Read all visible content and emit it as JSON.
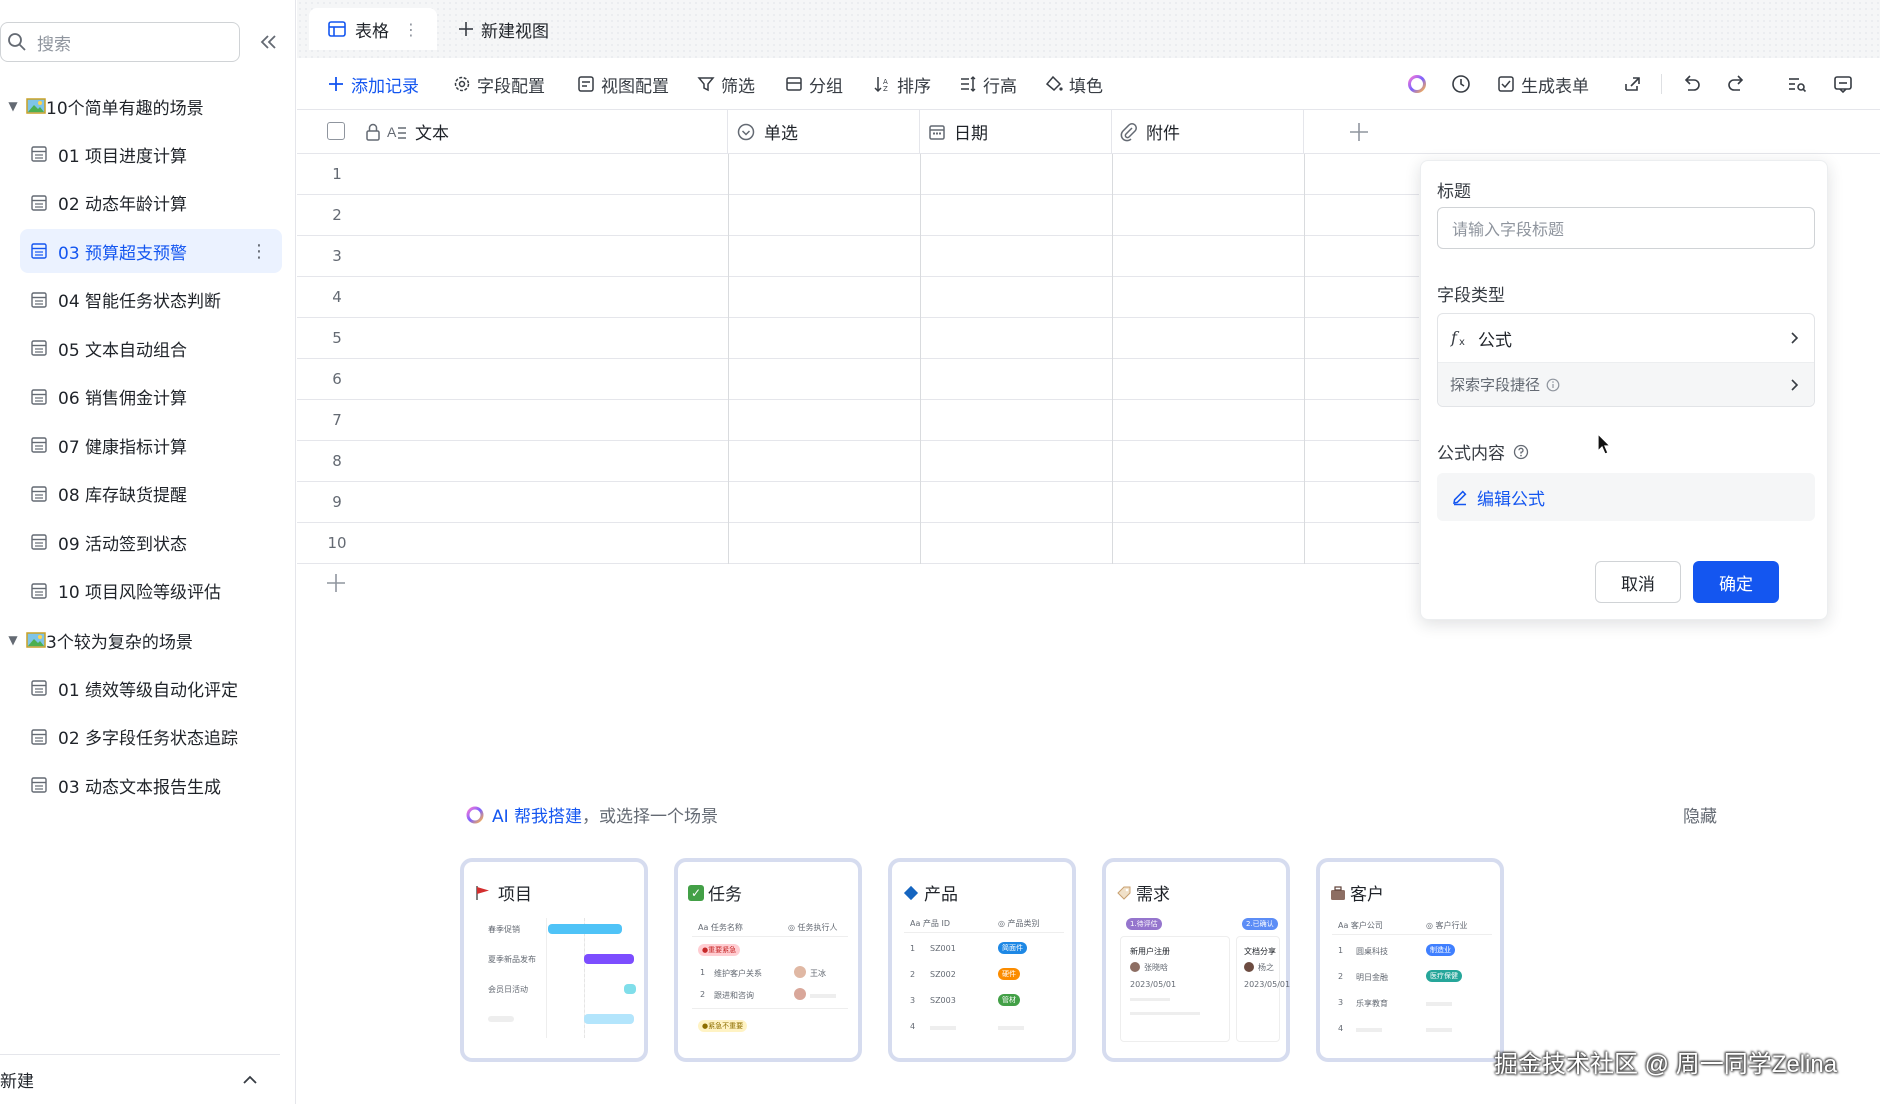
{
  "sidebar": {
    "search_placeholder": "搜索",
    "groups": [
      {
        "title": "10个简单有趣的场景",
        "items": [
          "01 项目进度计算",
          "02 动态年龄计算",
          "03 预算超支预警",
          "04 智能任务状态判断",
          "05 文本自动组合",
          "06 销售佣金计算",
          "07 健康指标计算",
          "08 库存缺货提醒",
          "09 活动签到状态",
          "10 项目风险等级评估"
        ]
      },
      {
        "title": "3个较为复杂的场景",
        "items": [
          "01 绩效等级自动化评定",
          "02 多字段任务状态追踪",
          "03 动态文本报告生成"
        ]
      }
    ],
    "active_item": "03 预算超支预警",
    "footer_label": "新建"
  },
  "views": {
    "active": "表格",
    "new_view": "新建视图"
  },
  "toolbar": {
    "add_record": "添加记录",
    "field_config": "字段配置",
    "view_config": "视图配置",
    "filter": "筛选",
    "group": "分组",
    "sort": "排序",
    "row_height": "行高",
    "fill": "填色",
    "generate_form": "生成表单"
  },
  "table": {
    "columns": [
      "文本",
      "单选",
      "日期",
      "附件"
    ],
    "rows": [
      "1",
      "2",
      "3",
      "4",
      "5",
      "6",
      "7",
      "8",
      "9",
      "10"
    ]
  },
  "panel": {
    "title_label": "标题",
    "title_placeholder": "请输入字段标题",
    "type_label": "字段类型",
    "type_value": "公式",
    "shortcut_label": "探索字段捷径",
    "formula_label": "公式内容",
    "edit_formula": "编辑公式",
    "cancel": "取消",
    "confirm": "确定"
  },
  "scenarios": {
    "ai_link": "AI 帮我搭建",
    "prompt": "，或选择一个场景",
    "hide": "隐藏",
    "cards": [
      {
        "title": "项目",
        "icon": "flag-icon"
      },
      {
        "title": "任务",
        "icon": "check-icon"
      },
      {
        "title": "产品",
        "icon": "diamond-icon"
      },
      {
        "title": "需求",
        "icon": "tag-icon"
      },
      {
        "title": "客户",
        "icon": "briefcase-icon"
      }
    ],
    "project_rows": [
      "春季促销",
      "夏季新品发布",
      "会员日活动"
    ],
    "task_headers": [
      "任务名称",
      "任务执行人"
    ],
    "task_tags": [
      "重要紧急",
      "紧急不重要"
    ],
    "task_rows": [
      "维护客户关系",
      "跟进和咨询"
    ],
    "task_assignee": "王冰",
    "product_headers": [
      "产品 ID",
      "产品类别"
    ],
    "product_ids": [
      "SZ001",
      "SZ002",
      "SZ003"
    ],
    "product_tags": [
      "简面件",
      "硬件",
      "管材"
    ],
    "demand_tags": [
      "1.待评估",
      "2.已确认"
    ],
    "demand_rows": [
      "新用户注册",
      "文档分享"
    ],
    "demand_people": [
      "张晓晗",
      "杨之"
    ],
    "demand_date": "2023/05/01",
    "customer_headers": [
      "客户公司",
      "客户行业"
    ],
    "customer_rows": [
      "圆桌科技",
      "明日金融",
      "乐享教育"
    ],
    "customer_tags": [
      "制造业",
      "医疗保健"
    ]
  },
  "watermark": "掘金技术社区 @ 周一同学Zelina",
  "colors": {
    "accent": "#1456f0",
    "active_bg": "#ebf2ff"
  }
}
